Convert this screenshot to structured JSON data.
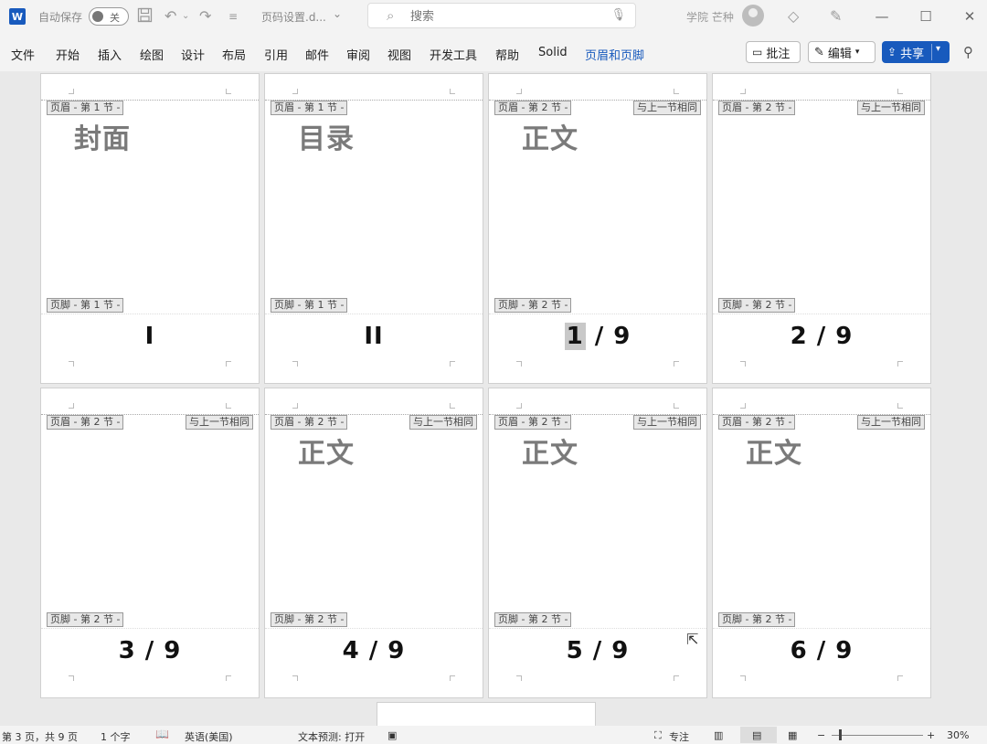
{
  "titlebar": {
    "app_icon": "W",
    "autosave_label": "自动保存",
    "autosave_state": "关",
    "doc_name": "页码设置.d...",
    "search_placeholder": "搜索",
    "user_name": "学院 芒种"
  },
  "ribbon": {
    "tabs": [
      "文件",
      "开始",
      "插入",
      "绘图",
      "设计",
      "布局",
      "引用",
      "邮件",
      "审阅",
      "视图",
      "开发工具",
      "帮助",
      "Solid",
      "页眉和页脚"
    ],
    "active_tab": "页眉和页脚",
    "comment_label": "批注",
    "edit_label": "编辑",
    "share_label": "共享"
  },
  "pages": [
    {
      "header": "页眉 - 第 1 节 -",
      "same_as_prev": "",
      "title": "封面",
      "footer": "页脚 - 第 1 节 -",
      "page_number": "I"
    },
    {
      "header": "页眉 - 第 1 节 -",
      "same_as_prev": "",
      "title": "目录",
      "footer": "页脚 - 第 1 节 -",
      "page_number": "II"
    },
    {
      "header": "页眉 - 第 2 节 -",
      "same_as_prev": "与上一节相同",
      "title": "正文",
      "footer": "页脚 - 第 2 节 -",
      "page_number_pre": "1",
      "page_number_post": " / 9"
    },
    {
      "header": "页眉 - 第 2 节 -",
      "same_as_prev": "与上一节相同",
      "title": "",
      "footer": "页脚 - 第 2 节 -",
      "page_number": "2 / 9"
    },
    {
      "header": "页眉 - 第 2 节 -",
      "same_as_prev": "与上一节相同",
      "title": "",
      "footer": "页脚 - 第 2 节 -",
      "page_number": "3 / 9"
    },
    {
      "header": "页眉 - 第 2 节 -",
      "same_as_prev": "与上一节相同",
      "title": "正文",
      "footer": "页脚 - 第 2 节 -",
      "page_number": "4 / 9"
    },
    {
      "header": "页眉 - 第 2 节 -",
      "same_as_prev": "与上一节相同",
      "title": "正文",
      "footer": "页脚 - 第 2 节 -",
      "page_number": "5 / 9"
    },
    {
      "header": "页眉 - 第 2 节 -",
      "same_as_prev": "与上一节相同",
      "title": "正文",
      "footer": "页脚 - 第 2 节 -",
      "page_number": "6 / 9"
    }
  ],
  "status": {
    "page_info": "第 3 页，共 9 页",
    "word_count": "1 个字",
    "language": "英语(美国)",
    "text_prediction": "文本预测: 打开",
    "focus_label": "专注",
    "zoom_minus": "−",
    "zoom_plus": "+",
    "zoom": "30%"
  },
  "icons": {
    "save": "save-icon",
    "undo": "undo-icon",
    "redo": "redo-icon",
    "search": "search-icon",
    "mic": "microphone-icon"
  }
}
